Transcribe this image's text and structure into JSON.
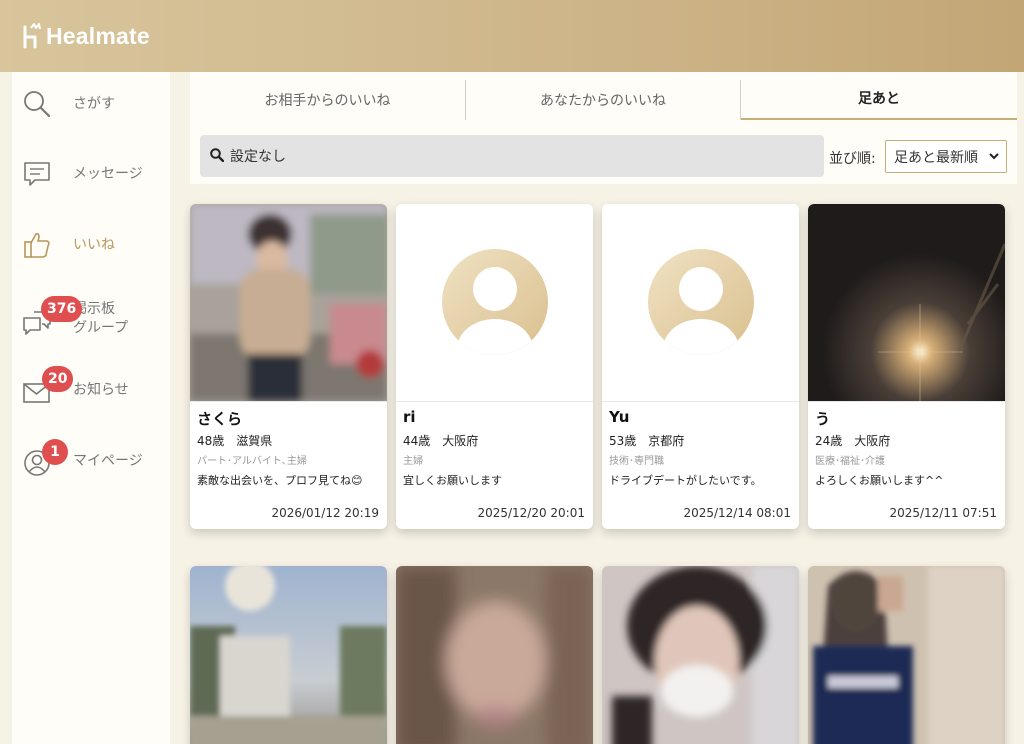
{
  "app": {
    "name": "Healmate"
  },
  "sidebar": {
    "items": [
      {
        "label": "さがす",
        "icon": "search-icon"
      },
      {
        "label": "メッセージ",
        "icon": "message-icon"
      },
      {
        "label": "いいね",
        "icon": "thumbs-up-icon",
        "active": true
      },
      {
        "label": "掲示板\nグループ",
        "label_line1": "掲示板",
        "label_line2": "グループ",
        "icon": "board-icon",
        "badge": "376"
      },
      {
        "label": "お知らせ",
        "icon": "mail-icon",
        "badge": "20"
      },
      {
        "label": "マイページ",
        "icon": "user-icon",
        "badge": "1"
      }
    ]
  },
  "tabs": [
    {
      "label": "お相手からのいいね"
    },
    {
      "label": "あなたからのいいね"
    },
    {
      "label": "足あと",
      "active": true
    }
  ],
  "search": {
    "value": "設定なし"
  },
  "sort": {
    "label": "並び順:",
    "selected": "足あと最新順"
  },
  "cards": [
    {
      "name": "さくら",
      "age_area": "48歳　滋賀県",
      "job": "パート･アルバイト､主婦",
      "message": "素敵な出会いを、プロフ見てね😊",
      "time": "2026/01/12 20:19",
      "photo": "photo"
    },
    {
      "name": "ri",
      "age_area": "44歳　大阪府",
      "job": "主婦",
      "message": "宜しくお願いします",
      "time": "2025/12/20 20:01",
      "photo": "default-avatar"
    },
    {
      "name": "Yu",
      "age_area": "53歳　京都府",
      "job": "技術･専門職",
      "message": "ドライブデートがしたいです。",
      "time": "2025/12/14 08:01",
      "photo": "default-avatar"
    },
    {
      "name": "う",
      "age_area": "24歳　大阪府",
      "job": "医療･福祉･介護",
      "message": "よろしくお願いします^^",
      "time": "2025/12/11 07:51",
      "photo": "photo"
    }
  ],
  "colors": {
    "accent": "#c9ad78",
    "badge": "#e04f4f",
    "header": "#cdb488"
  }
}
